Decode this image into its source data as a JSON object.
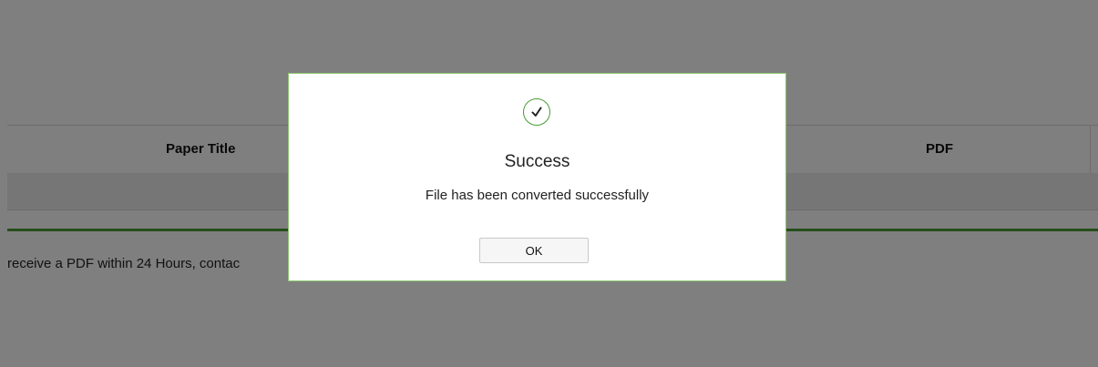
{
  "background": {
    "table": {
      "headers": {
        "paper_title": "Paper Title",
        "pdf": "PDF"
      }
    },
    "notice_text": "receive a PDF within 24 Hours, contac"
  },
  "modal": {
    "icon": "check-circle-icon",
    "title": "Success",
    "message": "File has been converted successfully",
    "ok_label": "OK",
    "accent_color": "#4a9a36"
  }
}
